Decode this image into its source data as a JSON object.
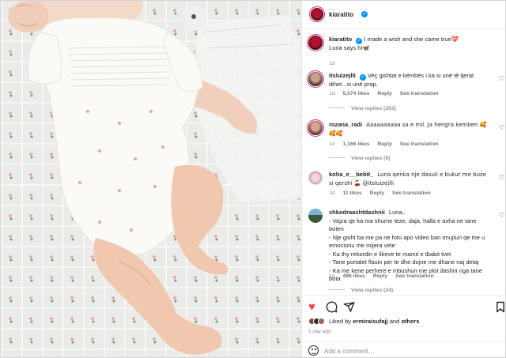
{
  "post": {
    "author": "kiaratito",
    "caption": "I made a wish and she came true💝\nLuna says hi🦋",
    "caption_time": "1d"
  },
  "comments": [
    {
      "user": "itsluizejlli",
      "verified": true,
      "text": "Veç gishtat e këmbës i ka si unë të tjerat dihet...si unë prap.",
      "time": "1d",
      "likes": "5,574 likes",
      "reply": "Reply",
      "translate": "See translation",
      "replies": "View replies (203)"
    },
    {
      "user": "rozana_radi",
      "verified": false,
      "text": "Aaaaaaaaaa sa e mil. Ja hengra kemben 🥰🥰🥰",
      "time": "1d",
      "likes": "1,166 likes",
      "reply": "Reply",
      "translate": "See translation",
      "replies": "View replies (9)"
    },
    {
      "user": "koha_e__bebit_",
      "verified": false,
      "text": "Luna qenka nje dasuli e bukur me buze si qershi 🍒 @itsluizejlli",
      "time": "1d",
      "likes": "11 likes",
      "reply": "Reply",
      "translate": "See translation",
      "replies": ""
    },
    {
      "user": "shkodraashtdashnii",
      "verified": false,
      "text": "Luna..\n- Vajza qe ka ma shume teze, daja, halla e axha ne tane boten\n- Nje gisht ba me pa ne foto apo video ban tmujtun qe me u emocionu me mijera vete\n- Ka thy rekordin e likeve te mamit e tbabit tvet\n- Tane portalet flasin per te dhe dojne me dhane naj detaj\n- Ka me kene perhere e mbushun me plot dashni nga tane bota",
      "time": "1d",
      "likes": "496 likes",
      "reply": "Reply",
      "translate": "See translation",
      "replies": "View replies (24)"
    }
  ],
  "likes_line": {
    "prefix": "Liked by",
    "user": "ermiraisufajj",
    "and": "and",
    "others": "others"
  },
  "timestamp": "1 day ago",
  "add_comment_placeholder": "Add a comment…",
  "colors": {
    "heart_red": "#ed4956",
    "verified_blue": "#0095f6",
    "muted_text": "#8e8e8e"
  }
}
